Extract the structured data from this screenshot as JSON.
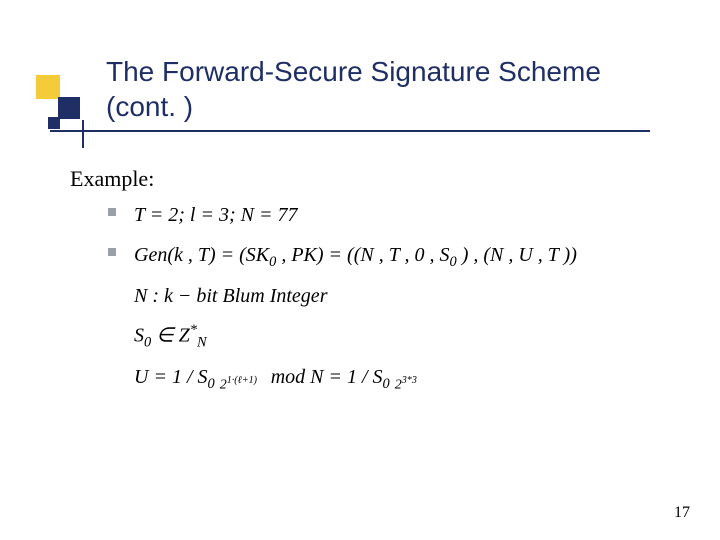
{
  "slide": {
    "title_line1": "The Forward-Secure Signature Scheme",
    "title_line2": "(cont. )",
    "example_label": "Example:",
    "row1": "T = 2;  l = 3;  N = 77",
    "gen_label": "Gen(k , T) = (SK",
    "gen_sub0": "0",
    "gen_mid": " , PK) = ((N , T , 0 , S",
    "gen_sub1": "0",
    "gen_tail": " ) , (N , U , T ))",
    "n_label": "N :  k − bit ",
    "blum": "Blum Integer",
    "s0_lhs": "S",
    "s0_sub": "0",
    "s0_in": " ∈ Z",
    "zn_sup": "*",
    "zn_sub": "N",
    "u_lhs": "U = 1 / S",
    "u_s_sub": "0",
    "u_exp_top": "1·(ℓ+1)",
    "u_modn": "  mod  N = 1 / S",
    "u_s_sub2": "0",
    "u_exp2_top": "3*3",
    "two": "2",
    "page": "17"
  }
}
